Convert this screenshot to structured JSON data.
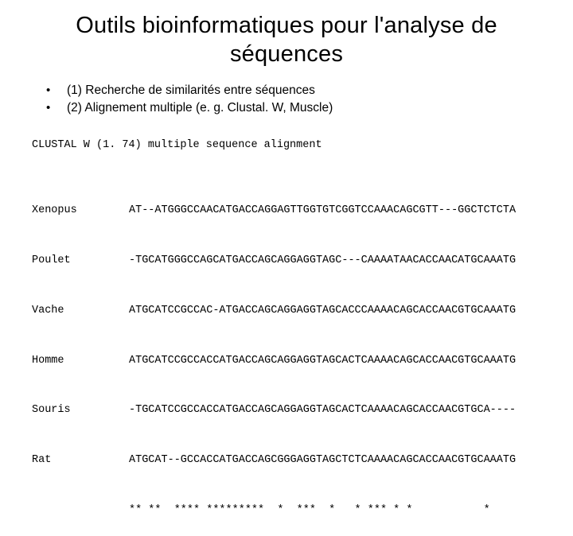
{
  "title": "Outils bioinformatiques pour l'analyse de séquences",
  "bullets": [
    {
      "mark": "•",
      "text": "(1) Recherche de similarités entre séquences"
    },
    {
      "mark": "•",
      "text": "(2) Alignement multiple (e. g. Clustal. W, Muscle)"
    }
  ],
  "clustal": {
    "header": "CLUSTAL W (1. 74) multiple sequence alignment",
    "rows": [
      {
        "label": "Xenopus",
        "seq": "AT--ATGGGCCAACATGACCAGGAGTTGGTGTCGGTCCAAACAGCGTT---GGCTCTCTA"
      },
      {
        "label": "Poulet",
        "seq": "-TGCATGGGCCAGCATGACCAGCAGGAGGTAGC---CAAAATAACACCAACATGCAAATG"
      },
      {
        "label": "Vache",
        "seq": "ATGCATCCGCCAC-ATGACCAGCAGGAGGTAGCACCCAAAACAGCACCAACGTGCAAATG"
      },
      {
        "label": "Homme",
        "seq": "ATGCATCCGCCACCATGACCAGCAGGAGGTAGCACTCAAAACAGCACCAACGTGCAAATG"
      },
      {
        "label": "Souris",
        "seq": "-TGCATCCGCCACCATGACCAGCAGGAGGTAGCACTCAAAACAGCACCAACGTGCA----"
      },
      {
        "label": "Rat",
        "seq": "ATGCAT--GCCACCATGACCAGCGGGAGGTAGCTCTCAAAACAGCACCAACGTGCAAATG"
      },
      {
        "label": "",
        "seq": "** **  **** *********  *  ***  *   * *** * *           *"
      }
    ]
  }
}
